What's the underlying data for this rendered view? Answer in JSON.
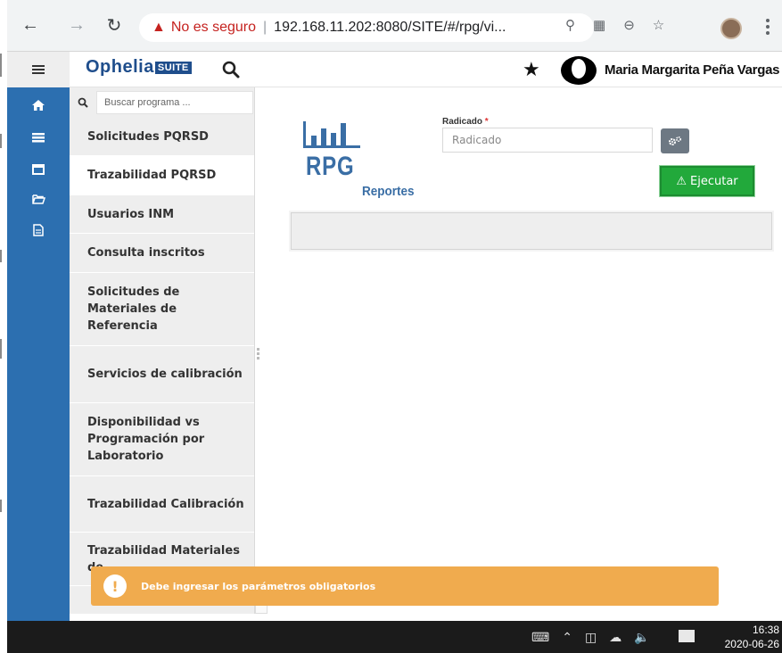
{
  "browser": {
    "security_label": "No es seguro",
    "url": "192.168.11.202:8080/SITE/#/rpg/vi..."
  },
  "header": {
    "logo_main": "Ophelia",
    "logo_suite": "SUITE",
    "user_name": "Maria Margarita Peña Vargas"
  },
  "sidebar": {
    "search_placeholder": "Buscar programa ...",
    "items": [
      {
        "label": "Solicitudes PQRSD"
      },
      {
        "label": "Trazabilidad PQRSD"
      },
      {
        "label": "Usuarios INM"
      },
      {
        "label": "Consulta inscritos"
      },
      {
        "label": "Solicitudes de Materiales de Referencia"
      },
      {
        "label": "Servicios de calibración"
      },
      {
        "label": "Disponibilidad vs Programación por Laboratorio"
      },
      {
        "label": "Trazabilidad Calibración"
      },
      {
        "label": "Trazabilidad Materiales de..."
      }
    ]
  },
  "report": {
    "logo_text": "RPG",
    "logo_sub": "Reportes",
    "field_label": "Radicado",
    "field_required": "*",
    "field_placeholder": "Radicado",
    "execute_label": "Ejecutar"
  },
  "toast": {
    "message": "Debe ingresar los parámetros obligatorios"
  },
  "taskbar": {
    "time": "16:38",
    "date": "2020-06-26"
  },
  "colors": {
    "rail": "#2c6fb0",
    "execute": "#22a93b",
    "toast": "#f0ab4e",
    "logo_blue": "#3a6ea5"
  }
}
